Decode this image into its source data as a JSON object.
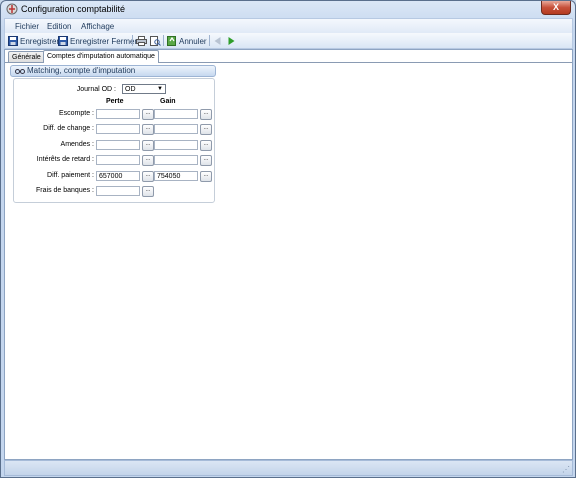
{
  "window": {
    "title": "Configuration comptabilité",
    "close_glyph": "X"
  },
  "menu": [
    "Fichier",
    "Edition",
    "Affichage"
  ],
  "toolbar": {
    "save_label": "Enregistrer",
    "save_close_label": "Enregistrer Fermer",
    "cancel_label": "Annuler"
  },
  "tabs": [
    "Générale",
    "Comptes d'imputation automatique"
  ],
  "section": {
    "title": "Matching, compte d'imputation"
  },
  "form": {
    "journal_label": "Journal OD :",
    "journal_value": "OD",
    "col_perte": "Perte",
    "col_gain": "Gain",
    "dots": "...",
    "rows": [
      {
        "label": "Escompte :",
        "perte": "",
        "gain": ""
      },
      {
        "label": "Diff. de change :",
        "perte": "",
        "gain": ""
      },
      {
        "label": "Amendes :",
        "perte": "",
        "gain": ""
      },
      {
        "label": "Intérêts de retard :",
        "perte": "",
        "gain": ""
      },
      {
        "label": "Diff. paiement :",
        "perte": "657000",
        "gain": "754050"
      },
      {
        "label": "Frais de banques :",
        "perte": ""
      }
    ]
  }
}
